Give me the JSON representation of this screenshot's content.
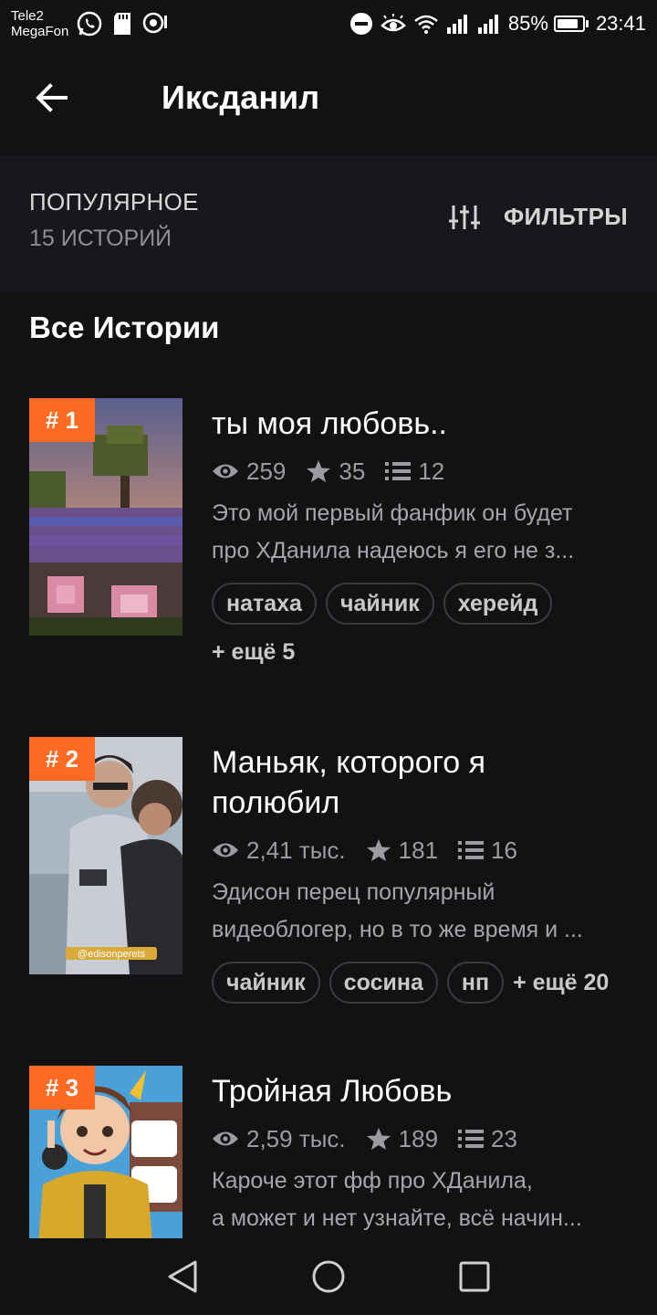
{
  "status_bar": {
    "carrier1": "Tele2",
    "carrier2": "MegaFon",
    "battery": "85%",
    "battery_level": 0.85,
    "time": "23:41"
  },
  "header": {
    "title": "Иксданил"
  },
  "section": {
    "title": "ПОПУЛЯРНОЕ",
    "count": "15 ИСТОРИЙ",
    "filters_label": "ФИЛЬТРЫ"
  },
  "all_stories_heading": "Все Истории",
  "stories": [
    {
      "rank": "# 1",
      "title_lines": [
        "ты моя любовь.."
      ],
      "views": "259",
      "stars": "35",
      "parts": "12",
      "desc_lines": [
        "Это мой первый фанфик он будет",
        "про ХДанила надеюсь я его не з..."
      ],
      "tags": [
        "натаха",
        "чайник",
        "херейд"
      ],
      "more": "+ ещё 5"
    },
    {
      "rank": "# 2",
      "title_lines": [
        "Маньяк, которого я",
        "полюбил"
      ],
      "views": "2,41 тыс.",
      "stars": "181",
      "parts": "16",
      "desc_lines": [
        "Эдисон перец популярный",
        "видеоблогер, но в то же время и ..."
      ],
      "tags": [
        "чайник",
        "сосина",
        "нп"
      ],
      "more": "+ ещё 20",
      "cover_caption": "@edisonperets"
    },
    {
      "rank": "# 3",
      "title_lines": [
        "Тройная Любовь"
      ],
      "views": "2,59 тыс.",
      "stars": "189",
      "parts": "23",
      "desc_lines": [
        "Кароче этот фф про ХДанила,",
        "а может и нет узнайте, всё начин..."
      ]
    }
  ],
  "colors": {
    "background": "#121114",
    "accent": "#ff6b22",
    "section_bg": "#18171b"
  }
}
